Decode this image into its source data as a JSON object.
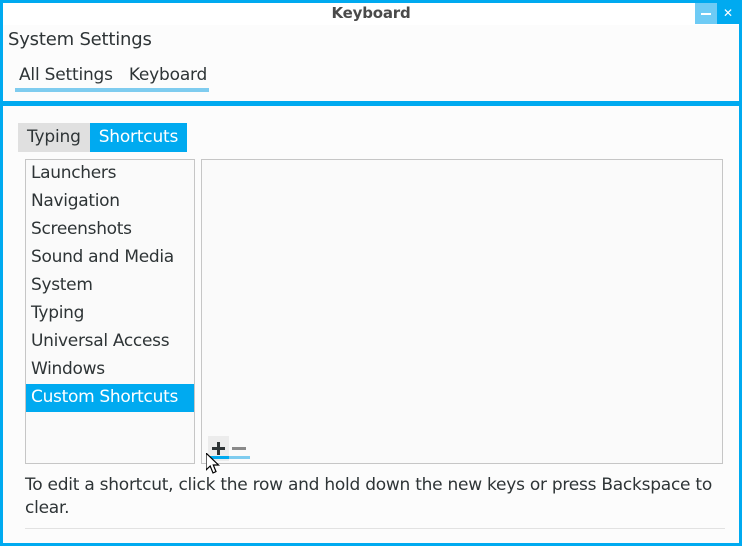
{
  "window": {
    "title": "Keyboard",
    "controls": {
      "minimize_label": "–",
      "close_label": "✕"
    },
    "colors": {
      "accent": "#00AAF0",
      "accent_light": "#7FCCEF",
      "minimize_bg": "#6ECBF5",
      "selection_bg": "#00AAF0",
      "tab_inactive_bg": "#E0E0E0",
      "panel_bg": "#FAFAFA",
      "panel_border": "#C6C6C6",
      "text": "#2E3436"
    }
  },
  "app_header": {
    "app_name": "System Settings",
    "nav_tabs": [
      {
        "label": "All Settings",
        "active": true
      },
      {
        "label": "Keyboard",
        "active": true
      }
    ]
  },
  "content": {
    "switcher_tabs": [
      {
        "label": "Typing",
        "selected": false
      },
      {
        "label": "Shortcuts",
        "selected": true
      }
    ],
    "categories": [
      {
        "label": "Launchers",
        "selected": false
      },
      {
        "label": "Navigation",
        "selected": false
      },
      {
        "label": "Screenshots",
        "selected": false
      },
      {
        "label": "Sound and Media",
        "selected": false
      },
      {
        "label": "System",
        "selected": false
      },
      {
        "label": "Typing",
        "selected": false
      },
      {
        "label": "Universal Access",
        "selected": false
      },
      {
        "label": "Windows",
        "selected": false
      },
      {
        "label": "Custom Shortcuts",
        "selected": true
      }
    ],
    "shortcuts_list": [],
    "toolbar": {
      "add_label": "+",
      "remove_label": "−"
    },
    "help_text": "To edit a shortcut, click the row and hold down the new keys or press Backspace to clear."
  }
}
